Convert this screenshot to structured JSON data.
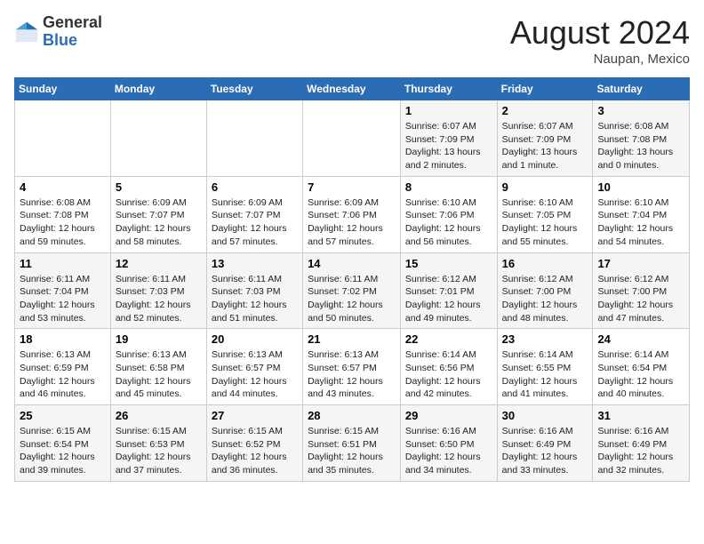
{
  "header": {
    "logo_line1": "General",
    "logo_line2": "Blue",
    "title": "August 2024",
    "subtitle": "Naupan, Mexico"
  },
  "days_of_week": [
    "Sunday",
    "Monday",
    "Tuesday",
    "Wednesday",
    "Thursday",
    "Friday",
    "Saturday"
  ],
  "weeks": [
    [
      {
        "day": "",
        "info": ""
      },
      {
        "day": "",
        "info": ""
      },
      {
        "day": "",
        "info": ""
      },
      {
        "day": "",
        "info": ""
      },
      {
        "day": "1",
        "info": "Sunrise: 6:07 AM\nSunset: 7:09 PM\nDaylight: 13 hours\nand 2 minutes."
      },
      {
        "day": "2",
        "info": "Sunrise: 6:07 AM\nSunset: 7:09 PM\nDaylight: 13 hours\nand 1 minute."
      },
      {
        "day": "3",
        "info": "Sunrise: 6:08 AM\nSunset: 7:08 PM\nDaylight: 13 hours\nand 0 minutes."
      }
    ],
    [
      {
        "day": "4",
        "info": "Sunrise: 6:08 AM\nSunset: 7:08 PM\nDaylight: 12 hours\nand 59 minutes."
      },
      {
        "day": "5",
        "info": "Sunrise: 6:09 AM\nSunset: 7:07 PM\nDaylight: 12 hours\nand 58 minutes."
      },
      {
        "day": "6",
        "info": "Sunrise: 6:09 AM\nSunset: 7:07 PM\nDaylight: 12 hours\nand 57 minutes."
      },
      {
        "day": "7",
        "info": "Sunrise: 6:09 AM\nSunset: 7:06 PM\nDaylight: 12 hours\nand 57 minutes."
      },
      {
        "day": "8",
        "info": "Sunrise: 6:10 AM\nSunset: 7:06 PM\nDaylight: 12 hours\nand 56 minutes."
      },
      {
        "day": "9",
        "info": "Sunrise: 6:10 AM\nSunset: 7:05 PM\nDaylight: 12 hours\nand 55 minutes."
      },
      {
        "day": "10",
        "info": "Sunrise: 6:10 AM\nSunset: 7:04 PM\nDaylight: 12 hours\nand 54 minutes."
      }
    ],
    [
      {
        "day": "11",
        "info": "Sunrise: 6:11 AM\nSunset: 7:04 PM\nDaylight: 12 hours\nand 53 minutes."
      },
      {
        "day": "12",
        "info": "Sunrise: 6:11 AM\nSunset: 7:03 PM\nDaylight: 12 hours\nand 52 minutes."
      },
      {
        "day": "13",
        "info": "Sunrise: 6:11 AM\nSunset: 7:03 PM\nDaylight: 12 hours\nand 51 minutes."
      },
      {
        "day": "14",
        "info": "Sunrise: 6:11 AM\nSunset: 7:02 PM\nDaylight: 12 hours\nand 50 minutes."
      },
      {
        "day": "15",
        "info": "Sunrise: 6:12 AM\nSunset: 7:01 PM\nDaylight: 12 hours\nand 49 minutes."
      },
      {
        "day": "16",
        "info": "Sunrise: 6:12 AM\nSunset: 7:00 PM\nDaylight: 12 hours\nand 48 minutes."
      },
      {
        "day": "17",
        "info": "Sunrise: 6:12 AM\nSunset: 7:00 PM\nDaylight: 12 hours\nand 47 minutes."
      }
    ],
    [
      {
        "day": "18",
        "info": "Sunrise: 6:13 AM\nSunset: 6:59 PM\nDaylight: 12 hours\nand 46 minutes."
      },
      {
        "day": "19",
        "info": "Sunrise: 6:13 AM\nSunset: 6:58 PM\nDaylight: 12 hours\nand 45 minutes."
      },
      {
        "day": "20",
        "info": "Sunrise: 6:13 AM\nSunset: 6:57 PM\nDaylight: 12 hours\nand 44 minutes."
      },
      {
        "day": "21",
        "info": "Sunrise: 6:13 AM\nSunset: 6:57 PM\nDaylight: 12 hours\nand 43 minutes."
      },
      {
        "day": "22",
        "info": "Sunrise: 6:14 AM\nSunset: 6:56 PM\nDaylight: 12 hours\nand 42 minutes."
      },
      {
        "day": "23",
        "info": "Sunrise: 6:14 AM\nSunset: 6:55 PM\nDaylight: 12 hours\nand 41 minutes."
      },
      {
        "day": "24",
        "info": "Sunrise: 6:14 AM\nSunset: 6:54 PM\nDaylight: 12 hours\nand 40 minutes."
      }
    ],
    [
      {
        "day": "25",
        "info": "Sunrise: 6:15 AM\nSunset: 6:54 PM\nDaylight: 12 hours\nand 39 minutes."
      },
      {
        "day": "26",
        "info": "Sunrise: 6:15 AM\nSunset: 6:53 PM\nDaylight: 12 hours\nand 37 minutes."
      },
      {
        "day": "27",
        "info": "Sunrise: 6:15 AM\nSunset: 6:52 PM\nDaylight: 12 hours\nand 36 minutes."
      },
      {
        "day": "28",
        "info": "Sunrise: 6:15 AM\nSunset: 6:51 PM\nDaylight: 12 hours\nand 35 minutes."
      },
      {
        "day": "29",
        "info": "Sunrise: 6:16 AM\nSunset: 6:50 PM\nDaylight: 12 hours\nand 34 minutes."
      },
      {
        "day": "30",
        "info": "Sunrise: 6:16 AM\nSunset: 6:49 PM\nDaylight: 12 hours\nand 33 minutes."
      },
      {
        "day": "31",
        "info": "Sunrise: 6:16 AM\nSunset: 6:49 PM\nDaylight: 12 hours\nand 32 minutes."
      }
    ]
  ]
}
